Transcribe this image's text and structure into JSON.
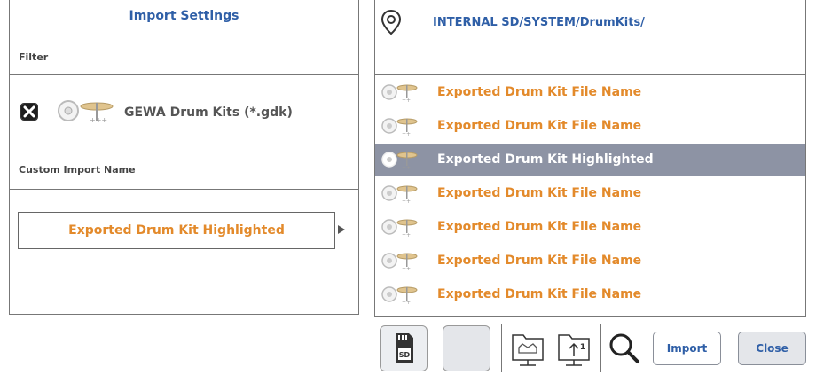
{
  "import_settings": {
    "title": "Import Settings",
    "filter_label": "Filter",
    "filter_option": "GEWA Drum Kits (*.gdk)",
    "filter_checked": true,
    "custom_name_label": "Custom Import Name",
    "custom_name_value": "Exported Drum Kit Highlighted"
  },
  "browser": {
    "path": "INTERNAL SD/SYSTEM/DrumKits/",
    "files": [
      {
        "label": "Exported Drum Kit File Name",
        "highlighted": false
      },
      {
        "label": "Exported Drum Kit File Name",
        "highlighted": false
      },
      {
        "label": "Exported Drum Kit Highlighted",
        "highlighted": true
      },
      {
        "label": "Exported Drum Kit File Name",
        "highlighted": false
      },
      {
        "label": "Exported Drum Kit File Name",
        "highlighted": false
      },
      {
        "label": "Exported Drum Kit File Name",
        "highlighted": false
      },
      {
        "label": "Exported Drum Kit File Name",
        "highlighted": false
      }
    ]
  },
  "toolbar": {
    "sd_icon_text": "SD",
    "folder_number": "1",
    "import_label": "Import",
    "close_label": "Close"
  },
  "colors": {
    "title_blue": "#2f5fa7",
    "orange": "#e38a2b",
    "highlight": "#8d93a4"
  }
}
